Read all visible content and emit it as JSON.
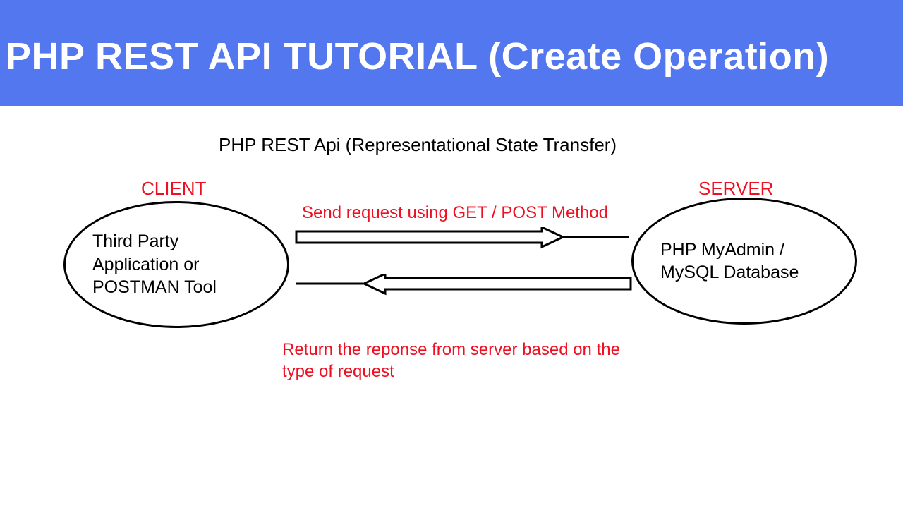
{
  "header": {
    "title": "PHP REST API TUTORIAL (Create Operation)"
  },
  "diagram": {
    "title": "PHP REST Api (Representational State Transfer)",
    "client_label": "CLIENT",
    "server_label": "SERVER",
    "client_text": "Third Party Application or POSTMAN Tool",
    "server_text": "PHP MyAdmin / MySQL Database",
    "request_label": "Send request using GET / POST Method",
    "response_label": "Return the reponse from server based on the type of request"
  }
}
